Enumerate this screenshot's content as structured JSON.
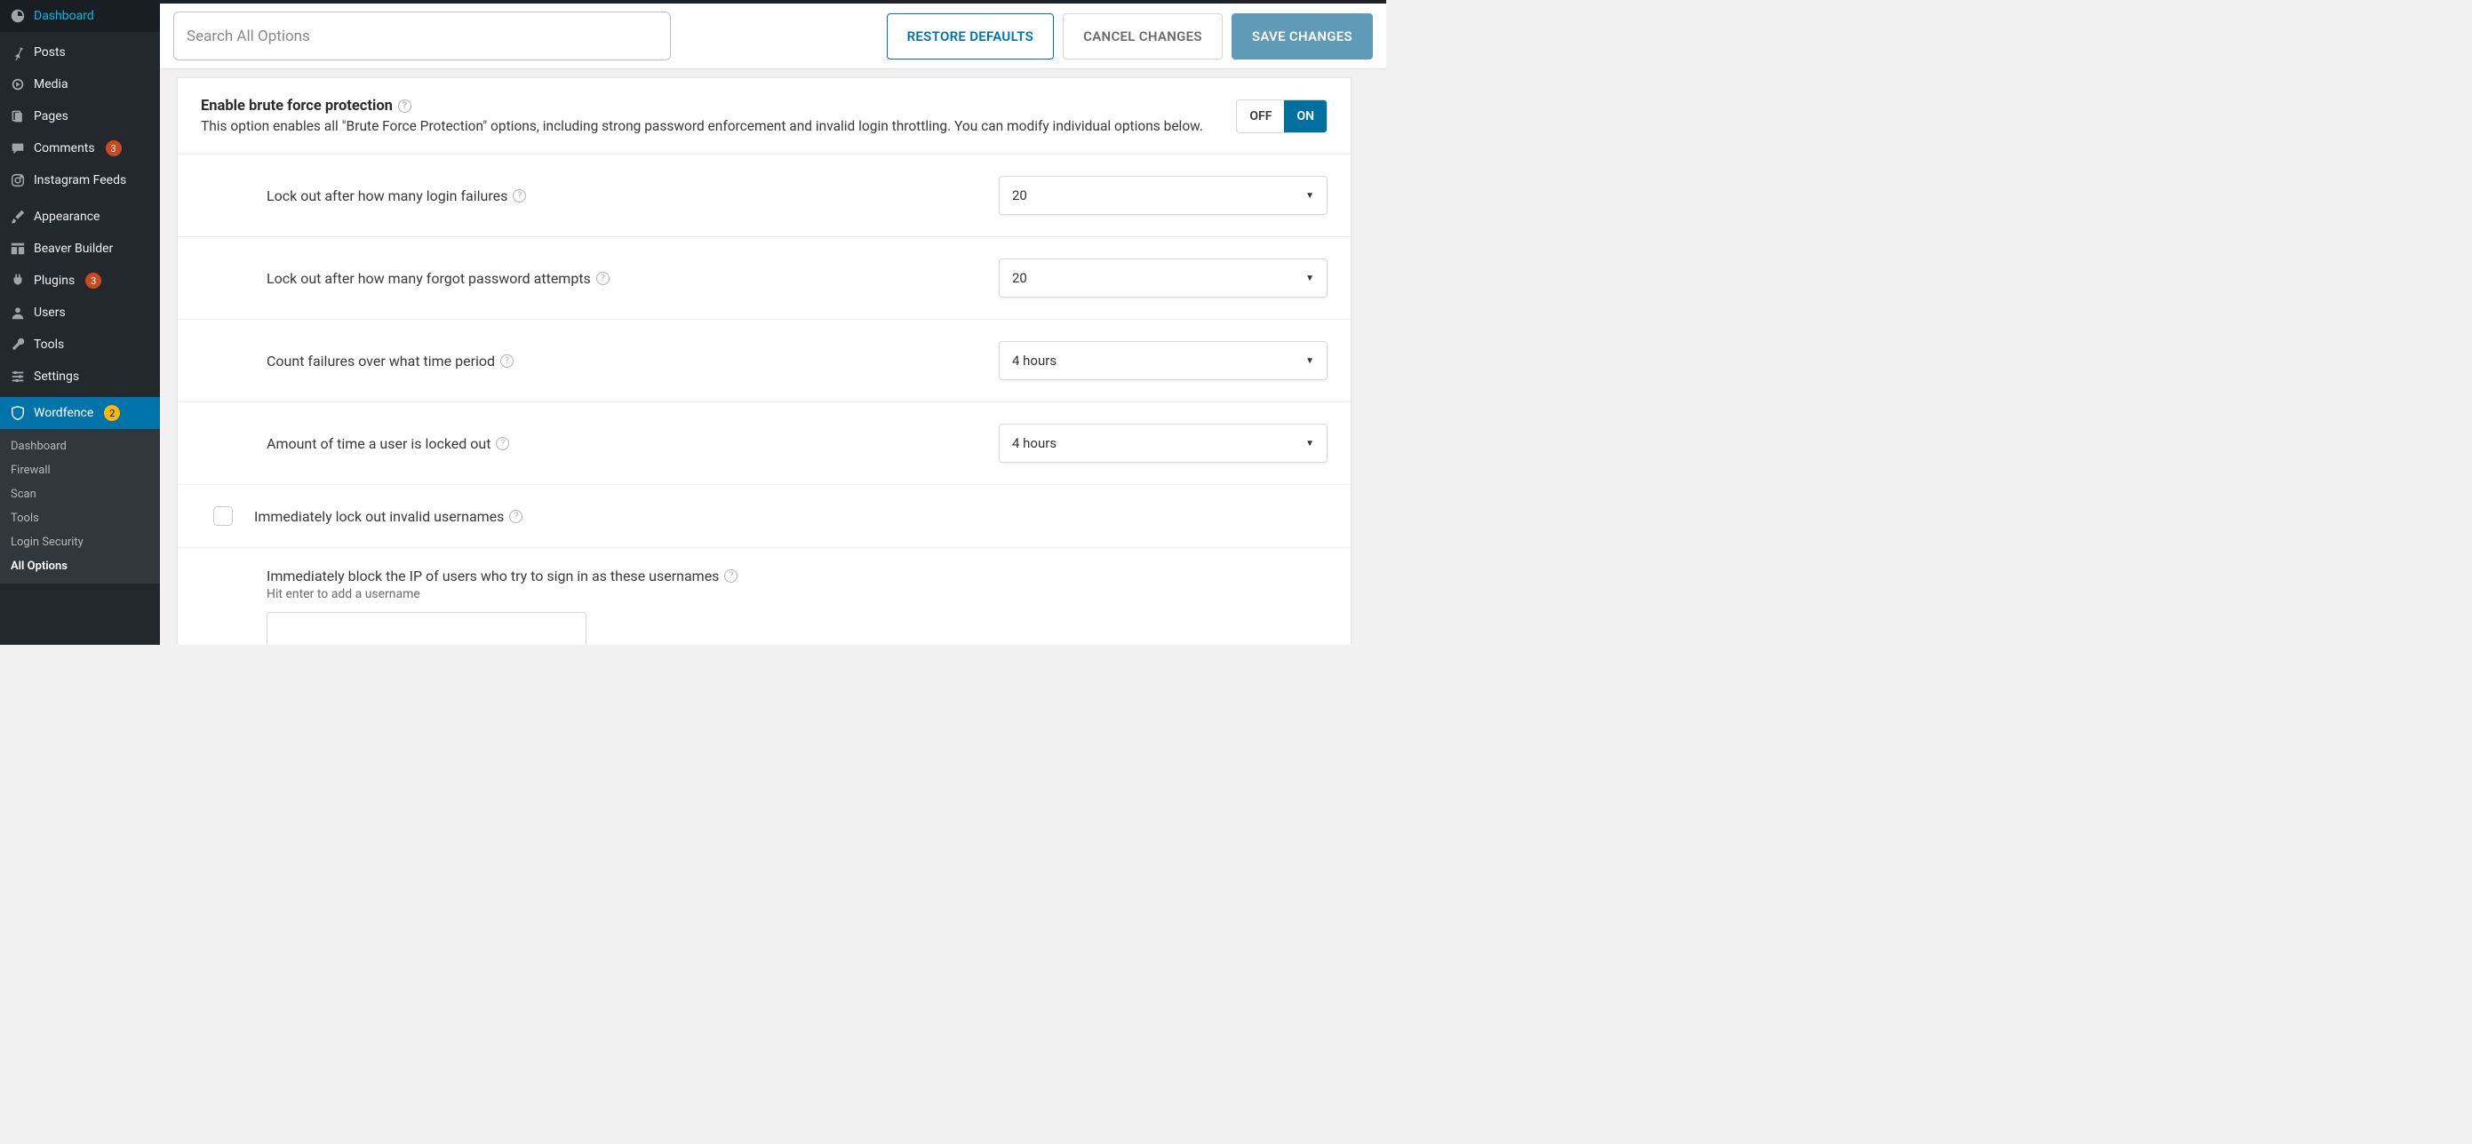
{
  "sidebar": {
    "items": [
      {
        "label": "Dashboard"
      },
      {
        "label": "Posts"
      },
      {
        "label": "Media"
      },
      {
        "label": "Pages"
      },
      {
        "label": "Comments",
        "badge": "3"
      },
      {
        "label": "Instagram Feeds"
      },
      {
        "label": "Appearance"
      },
      {
        "label": "Beaver Builder"
      },
      {
        "label": "Plugins",
        "badge": "3"
      },
      {
        "label": "Users"
      },
      {
        "label": "Tools"
      },
      {
        "label": "Settings"
      },
      {
        "label": "Wordfence",
        "badge": "2"
      }
    ],
    "submenu": [
      "Dashboard",
      "Firewall",
      "Scan",
      "Tools",
      "Login Security",
      "All Options"
    ]
  },
  "toolbar": {
    "search_placeholder": "Search All Options",
    "restore": "RESTORE DEFAULTS",
    "cancel": "CANCEL CHANGES",
    "save": "SAVE CHANGES"
  },
  "bruteforce": {
    "title": "Enable brute force protection",
    "desc": "This option enables all \"Brute Force Protection\" options, including strong password enforcement and invalid login throttling. You can modify individual options below.",
    "toggle": {
      "off": "OFF",
      "on": "ON"
    }
  },
  "options": {
    "login_failures": {
      "label": "Lock out after how many login failures",
      "value": "20"
    },
    "forgot_password": {
      "label": "Lock out after how many forgot password attempts",
      "value": "20"
    },
    "count_period": {
      "label": "Count failures over what time period",
      "value": "4 hours"
    },
    "lockout_time": {
      "label": "Amount of time a user is locked out",
      "value": "4 hours"
    },
    "lock_invalid": {
      "label": "Immediately lock out invalid usernames"
    },
    "block_ip": {
      "label": "Immediately block the IP of users who try to sign in as these usernames",
      "hint": "Hit enter to add a username"
    }
  }
}
